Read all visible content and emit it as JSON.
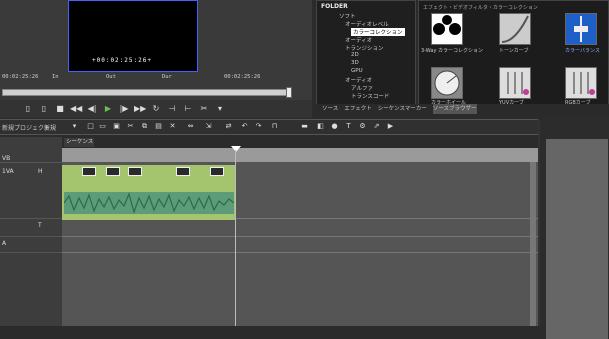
{
  "preview": {
    "center_timecode": "+00:02:25:26+",
    "tc_left": "00:02:25:26",
    "in_label": "In",
    "out_label": "Out",
    "dur_label": "Dur",
    "tc_right": "00:02:25:26"
  },
  "folder": {
    "title": "FOLDER",
    "tree": [
      "ソフト",
      "オーディオレベル",
      "カラーコレクション",
      "オーディオ",
      "トランジション",
      "2D",
      "3D",
      "GPU",
      "オーディオ",
      "アルファ",
      "トランスコード"
    ]
  },
  "assets": {
    "path": "エフェクト・ビデオフィルタ・カラーコレクション",
    "items": [
      {
        "label": "3-Way カラーコレクション",
        "icon": "threeway-icon"
      },
      {
        "label": "トーンカーブ",
        "icon": "curve-icon"
      },
      {
        "label": "カラーバランス",
        "icon": "balance-icon"
      },
      {
        "label": "カラーホイール",
        "icon": "wheel-icon"
      },
      {
        "label": "YUVカーブ",
        "icon": "yuv-icon"
      },
      {
        "label": "RGBカーブ",
        "icon": "rgb-icon"
      }
    ]
  },
  "bin_tabs": [
    "ソース",
    "エフェクト",
    "シーケンスマーカー",
    "ソースブラウザー"
  ],
  "timeline": {
    "tabs": [
      "新規プロジェクト",
      "新規"
    ],
    "sequence_tab": "シーケンス1",
    "tracks": [
      "1VA",
      "H",
      "1A",
      "T",
      "A"
    ]
  }
}
